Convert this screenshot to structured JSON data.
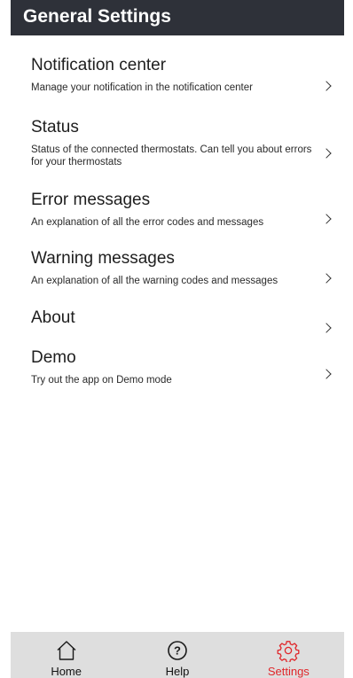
{
  "header": {
    "title": "General Settings"
  },
  "settings": {
    "items": [
      {
        "title": "Notification center",
        "description": "Manage your notification in the notification center"
      },
      {
        "title": "Status",
        "description": "Status of the connected thermostats. Can tell you about errors for your thermostats"
      },
      {
        "title": "Error messages",
        "description": "An explanation of all the error codes and messages"
      },
      {
        "title": "Warning messages",
        "description": "An explanation of all the warning codes and messages"
      },
      {
        "title": "About"
      },
      {
        "title": "Demo",
        "description": "Try out the app on Demo mode"
      }
    ]
  },
  "nav": {
    "active_color": "#e0262a",
    "items": [
      {
        "label": "Home",
        "icon": "home-icon"
      },
      {
        "label": "Help",
        "icon": "help-icon"
      },
      {
        "label": "Settings",
        "icon": "gear-icon",
        "active": true
      }
    ]
  }
}
